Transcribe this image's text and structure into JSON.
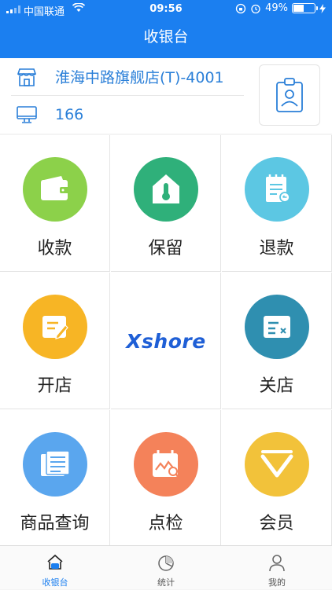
{
  "status_bar": {
    "carrier": "中国联通",
    "time": "09:56",
    "battery": "49%",
    "battery_level": 0.49
  },
  "navbar": {
    "title": "收银台"
  },
  "store": {
    "name": "淮海中路旗舰店(T)-4001",
    "terminal": "166"
  },
  "grid": {
    "items": [
      {
        "label": "收款",
        "color": "#8cd14a",
        "icon": "wallet-icon"
      },
      {
        "label": "保留",
        "color": "#2fb07a",
        "icon": "home-thermometer-icon"
      },
      {
        "label": "退款",
        "color": "#5cc7e3",
        "icon": "refund-note-icon"
      },
      {
        "label": "开店",
        "color": "#f7b525",
        "icon": "edit-note-icon"
      },
      {
        "label": "关店",
        "color": "#2f8fb0",
        "icon": "close-note-icon"
      },
      {
        "label": "商品查询",
        "color": "#5aa6ee",
        "icon": "document-list-icon"
      },
      {
        "label": "点检",
        "color": "#f4825a",
        "icon": "calendar-search-icon"
      },
      {
        "label": "会员",
        "color": "#f2c23a",
        "icon": "member-chevron-icon"
      }
    ],
    "logo": "Xshore"
  },
  "tabbar": {
    "tabs": [
      {
        "label": "收银台",
        "icon": "cashier-icon",
        "active": true
      },
      {
        "label": "统计",
        "icon": "pie-chart-icon",
        "active": false
      },
      {
        "label": "我的",
        "icon": "user-icon",
        "active": false
      }
    ]
  },
  "colors": {
    "primary": "#1b7ff0",
    "store_text": "#2a7fd8",
    "logo": "#1f5fd6"
  }
}
